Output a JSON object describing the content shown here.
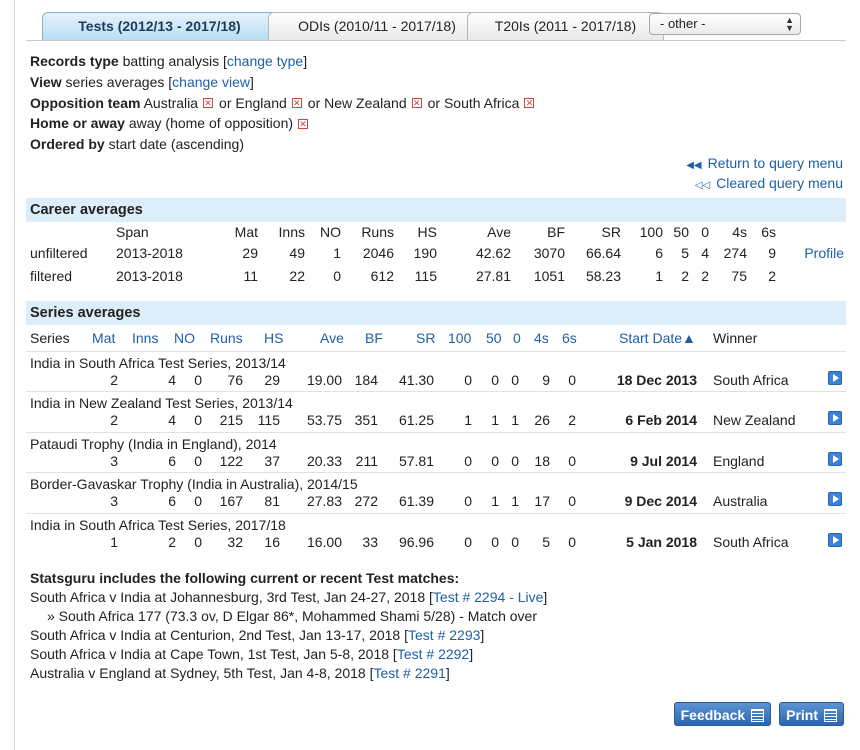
{
  "tabs": [
    {
      "label": "Tests (2012/13 - 2017/18)",
      "active": true
    },
    {
      "label": "ODIs (2010/11 - 2017/18)",
      "active": false
    },
    {
      "label": "T20Is (2011 - 2017/18)",
      "active": false
    }
  ],
  "other_select": {
    "value": "- other -"
  },
  "criteria": {
    "records_type_label": "Records type",
    "records_type_value": "batting analysis",
    "change_type": "change type",
    "view_label": "View",
    "view_value": "series averages",
    "change_view": "change view",
    "opposition_label": "Opposition team",
    "opposition_teams": [
      "Australia",
      "England",
      "New Zealand",
      "South Africa"
    ],
    "or_text": "or",
    "home_away_label": "Home or away",
    "home_away_value": "away (home of opposition)",
    "ordered_label": "Ordered by",
    "ordered_value": "start date (ascending)"
  },
  "query_links": {
    "return": "Return to query menu",
    "cleared": "Cleared query menu"
  },
  "career": {
    "title": "Career averages",
    "headers": [
      "",
      "Span",
      "Mat",
      "Inns",
      "NO",
      "Runs",
      "HS",
      "Ave",
      "BF",
      "SR",
      "100",
      "50",
      "0",
      "4s",
      "6s",
      ""
    ],
    "rows": [
      [
        "unfiltered",
        "2013-2018",
        "29",
        "49",
        "1",
        "2046",
        "190",
        "42.62",
        "3070",
        "66.64",
        "6",
        "5",
        "4",
        "274",
        "9",
        "Profile"
      ],
      [
        "filtered",
        "2013-2018",
        "11",
        "22",
        "0",
        "612",
        "115",
        "27.81",
        "1051",
        "58.23",
        "1",
        "2",
        "2",
        "75",
        "2",
        ""
      ]
    ]
  },
  "series": {
    "title": "Series averages",
    "headers": [
      "Series",
      "Mat",
      "Inns",
      "NO",
      "Runs",
      "HS",
      "Ave",
      "BF",
      "SR",
      "100",
      "50",
      "0",
      "4s",
      "6s",
      "Start Date▲",
      "Winner"
    ],
    "rows": [
      {
        "name": "India in South Africa Test Series, 2013/14",
        "vals": [
          "2",
          "4",
          "0",
          "76",
          "29",
          "19.00",
          "184",
          "41.30",
          "0",
          "0",
          "0",
          "9",
          "0"
        ],
        "date": "18 Dec 2013",
        "winner": "South Africa"
      },
      {
        "name": "India in New Zealand Test Series, 2013/14",
        "vals": [
          "2",
          "4",
          "0",
          "215",
          "115",
          "53.75",
          "351",
          "61.25",
          "1",
          "1",
          "1",
          "26",
          "2"
        ],
        "date": "6 Feb 2014",
        "winner": "New Zealand"
      },
      {
        "name": "Pataudi Trophy (India in England), 2014",
        "vals": [
          "3",
          "6",
          "0",
          "122",
          "37",
          "20.33",
          "211",
          "57.81",
          "0",
          "0",
          "0",
          "18",
          "0"
        ],
        "date": "9 Jul 2014",
        "winner": "England"
      },
      {
        "name": "Border-Gavaskar Trophy (India in Australia), 2014/15",
        "vals": [
          "3",
          "6",
          "0",
          "167",
          "81",
          "27.83",
          "272",
          "61.39",
          "0",
          "1",
          "1",
          "17",
          "0"
        ],
        "date": "9 Dec 2014",
        "winner": "Australia"
      },
      {
        "name": "India in South Africa Test Series, 2017/18",
        "vals": [
          "1",
          "2",
          "0",
          "32",
          "16",
          "16.00",
          "33",
          "96.96",
          "0",
          "0",
          "0",
          "5",
          "0"
        ],
        "date": "5 Jan 2018",
        "winner": "South Africa"
      }
    ]
  },
  "recent": {
    "title": "Statsguru includes the following current or recent Test matches:",
    "items": [
      {
        "text": "South Africa v India at Johannesburg, 3rd Test, Jan 24-27, 2018",
        "link": "Test # 2294 - Live"
      },
      {
        "text": "» South Africa 177 (73.3 ov, D Elgar 86*, Mohammed Shami 5/28) - Match over",
        "link": ""
      },
      {
        "text": "South Africa v India at Centurion, 2nd Test, Jan 13-17, 2018",
        "link": "Test # 2293"
      },
      {
        "text": "South Africa v India at Cape Town, 1st Test, Jan 5-8, 2018",
        "link": "Test # 2292"
      },
      {
        "text": "Australia v England at Sydney, 5th Test, Jan 4-8, 2018",
        "link": "Test # 2291"
      }
    ]
  },
  "buttons": {
    "feedback": "Feedback",
    "print": "Print"
  }
}
